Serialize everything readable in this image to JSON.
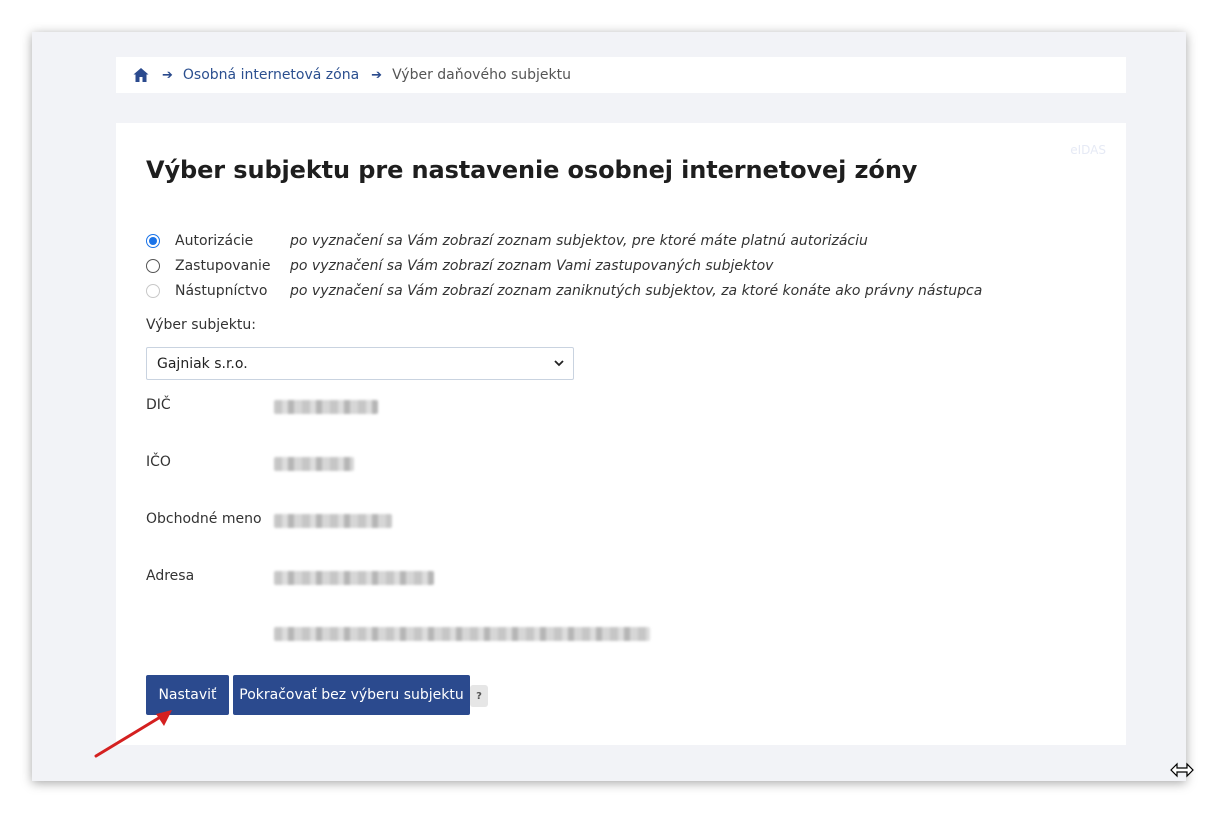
{
  "breadcrumb": {
    "home_icon": "home-icon",
    "items": [
      "Osobná internetová zóna",
      "Výber daňového subjektu"
    ]
  },
  "card": {
    "eidas": "eIDAS",
    "title": "Výber subjektu pre nastavenie osobnej internetovej zóny",
    "radios": [
      {
        "label": "Autorizácie",
        "desc": "po vyznačení sa Vám zobrazí zoznam subjektov, pre ktoré máte platnú autorizáciu",
        "state": "checked"
      },
      {
        "label": "Zastupovanie",
        "desc": "po vyznačení sa Vám zobrazí zoznam Vami zastupovaných subjektov",
        "state": "unchecked"
      },
      {
        "label": "Nástupníctvo",
        "desc": "po vyznačení sa Vám zobrazí zoznam zaniknutých subjektov, za ktoré konáte ako právny nástupca",
        "state": "disabled"
      }
    ],
    "select_label": "Výber subjektu:",
    "select_value": "Gajniak s.r.o.",
    "fields": {
      "dic": "DIČ",
      "ico": "IČO",
      "name": "Obchodné meno",
      "address": "Adresa"
    },
    "buttons": {
      "set": "Nastaviť",
      "continue": "Pokračovať bez výberu subjektu",
      "help": "?"
    }
  },
  "colors": {
    "primary": "#2b4a8e",
    "background": "#f2f3f7",
    "radio_checked": "#1a73e8",
    "annotation_arrow": "#d42020"
  }
}
